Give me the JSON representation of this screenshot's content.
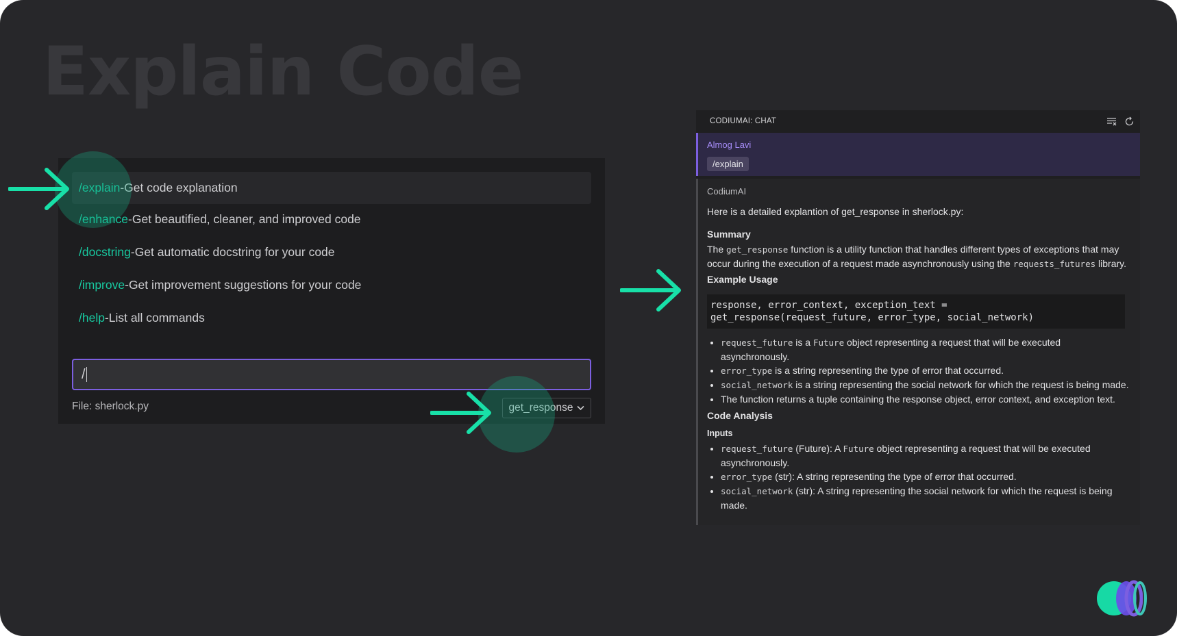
{
  "hero": {
    "title": "Explain Code"
  },
  "commands": [
    {
      "name": "/explain",
      "desc": "Get code explanation"
    },
    {
      "name": "/enhance",
      "desc": "Get beautified, cleaner, and improved code"
    },
    {
      "name": "/docstring",
      "desc": "Get automatic docstring for your code"
    },
    {
      "name": "/improve",
      "desc": "Get improvement suggestions for your code"
    },
    {
      "name": "/help",
      "desc": "List all commands"
    }
  ],
  "separator": " - ",
  "input": {
    "value": "/"
  },
  "file_label": "File: sherlock.py",
  "function_select": {
    "selected": "get_response"
  },
  "chat": {
    "title": "CODIUMAI: CHAT",
    "user": {
      "name": "Almog Lavi",
      "command": "/explain"
    },
    "ai": {
      "name": "CodiumAI",
      "intro": "Here is a detailed explantion of get_response in sherlock.py:",
      "summary_heading": "Summary",
      "summary": {
        "pre": "The ",
        "fn": "get_response",
        "mid": " function is a utility function that handles different types of exceptions that may occur during the execution of a request made asynchronously using the ",
        "lib": "requests_futures",
        "post": " library."
      },
      "example_heading": "Example Usage",
      "code": "response, error_context, exception_text =\nget_response(request_future, error_type, social_network)",
      "bullets": [
        {
          "code": "request_future",
          "text": " is a ",
          "code2": "Future",
          "text2": " object representing a request that will be executed asynchronously."
        },
        {
          "code": "error_type",
          "text": " is a string representing the type of error that occurred."
        },
        {
          "code": "social_network",
          "text": " is a string representing the social network for which the request is being made."
        },
        {
          "text": "The function returns a tuple containing the response object, error context, and exception text."
        }
      ],
      "analysis_heading": "Code Analysis",
      "inputs_heading": "Inputs",
      "inputs": [
        {
          "code": "request_future",
          "text": " (Future): A ",
          "code2": "Future",
          "text2": " object representing a request that will be executed asynchronously."
        },
        {
          "code": "error_type",
          "text": " (str): A string representing the type of error that occurred."
        },
        {
          "code": "social_network",
          "text": " (str): A string representing the social network for which the request is being made."
        }
      ]
    }
  },
  "colors": {
    "accent_green": "#18c9a0",
    "accent_purple": "#7c5fe0",
    "background": "#27272a"
  },
  "icons": [
    "arrow-right-icon",
    "clear-chat-icon",
    "refresh-icon",
    "chevron-down-icon",
    "codiumai-logo"
  ]
}
